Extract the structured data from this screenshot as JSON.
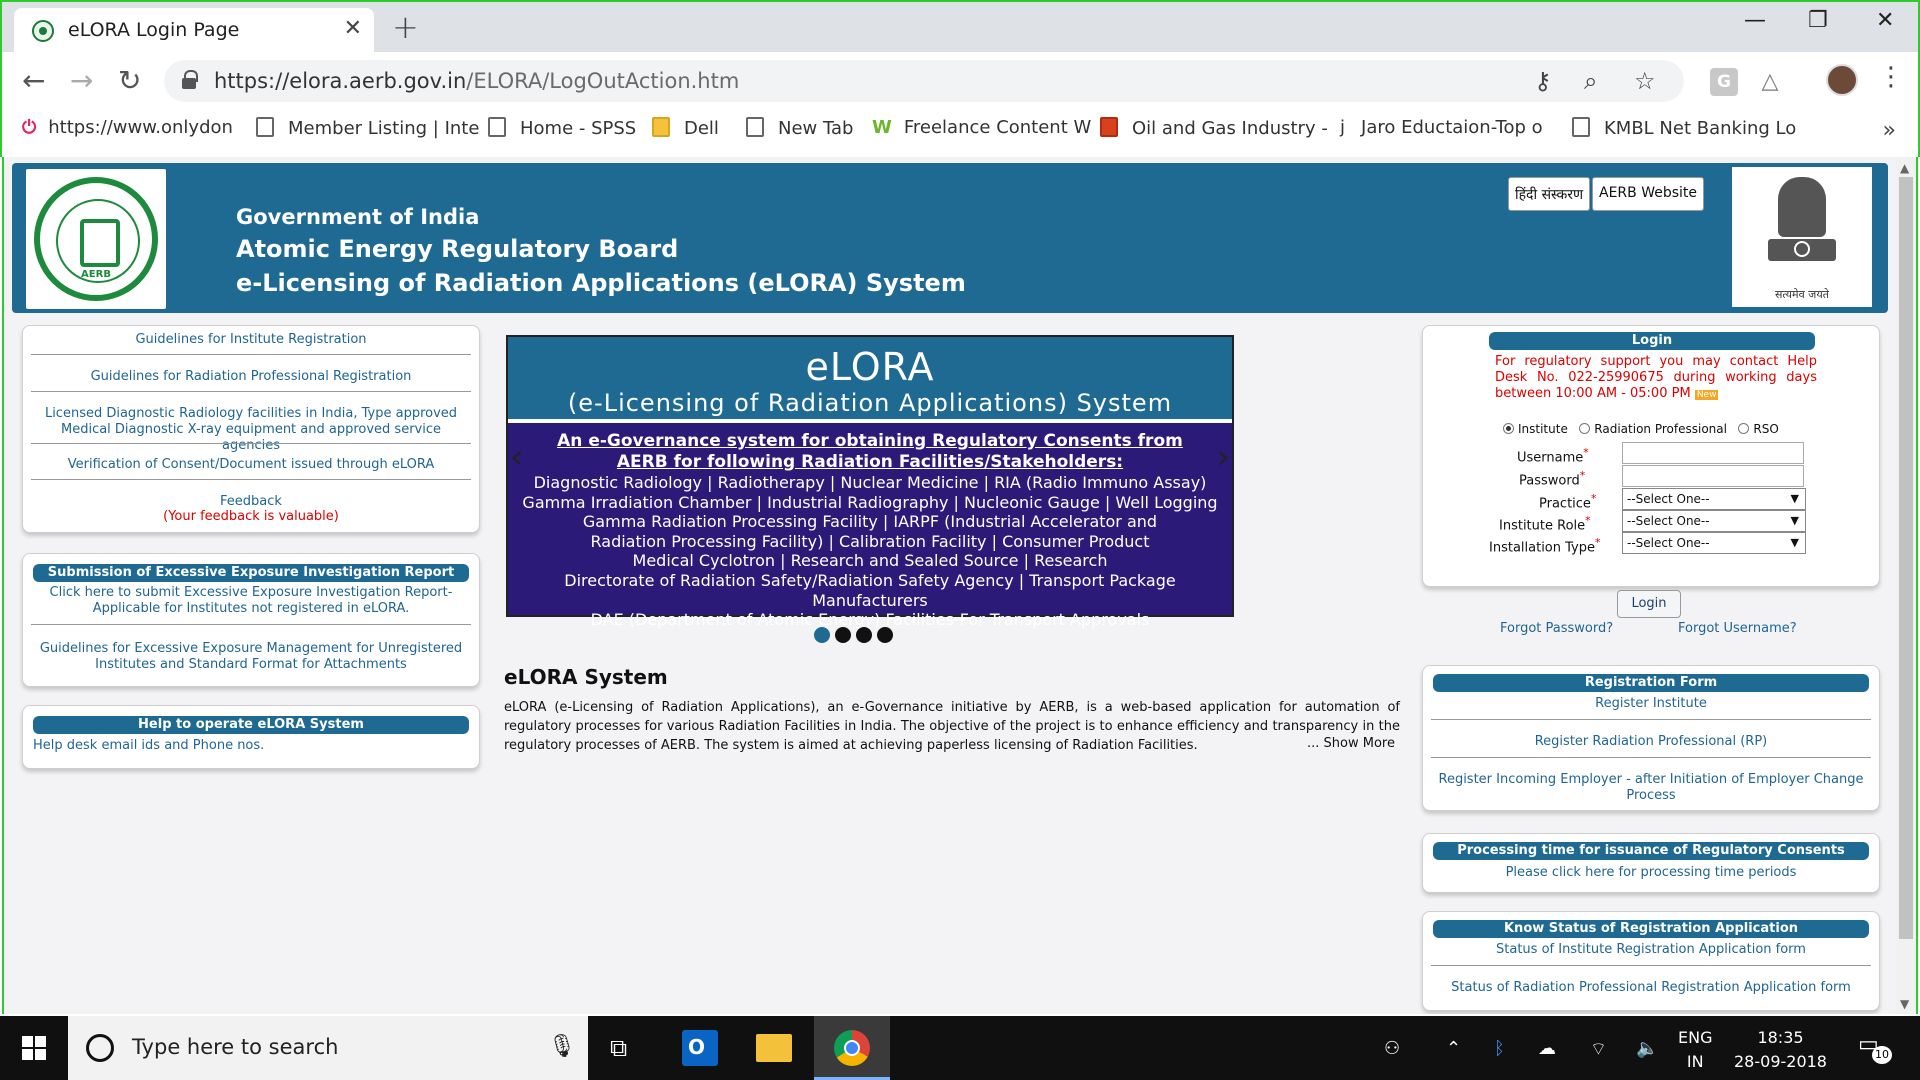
{
  "browser": {
    "tab_title": "eLORA Login Page",
    "url_host": "https://elora.aerb.gov.in",
    "url_path": "/ELORA/LogOutAction.htm",
    "bookmarks": [
      "https://www.onlydon",
      "Member Listing | Inte",
      "Home - SPSS",
      "Dell",
      "New Tab",
      "Freelance Content W",
      "Oil and Gas Industry -",
      "Jaro Eductaion-Top o",
      "KMBL Net Banking Lo"
    ]
  },
  "header": {
    "line1": "Government of India",
    "line2": "Atomic Energy Regulatory Board",
    "line3": "e-Licensing of Radiation Applications (eLORA) System",
    "hindi_button": "हिंदी संस्करण",
    "website_button": "AERB Website",
    "logo_text": "AERB",
    "emblem_text": "सत्यमेव जयते"
  },
  "left": {
    "links": [
      "Guidelines for Institute Registration",
      "Guidelines for Radiation Professional Registration",
      "Licensed Diagnostic Radiology facilities in India, Type approved Medical Diagnostic X-ray equipment and approved service agencies",
      "Verification of Consent/Document issued through eLORA",
      "Feedback"
    ],
    "feedback_note": "(Your feedback is valuable)",
    "exposure_title": "Submission of Excessive Exposure Investigation Report",
    "exposure_link": "Click here to submit Excessive Exposure Investigation Report-Applicable for Institutes not registered in eLORA.",
    "exposure_guidelines": "Guidelines for Excessive Exposure Management for Unregistered Institutes and Standard Format for Attachments",
    "help_title": "Help to operate eLORA System",
    "help_link": "Help desk email ids and Phone nos."
  },
  "carousel": {
    "title": "eLORA",
    "subtitle": "(e-Licensing of Radiation Applications) System",
    "heading1": "An e-Governance system for obtaining Regulatory Consents from",
    "heading2": "AERB for following Radiation Facilities/Stakeholders:",
    "lines": [
      "Diagnostic Radiology | Radiotherapy | Nuclear Medicine | RIA (Radio Immuno Assay)",
      "Gamma Irradiation Chamber | Industrial Radiography | Nucleonic Gauge | Well Logging",
      "Gamma Radiation Processing Facility | IARPF (Industrial Accelerator and",
      "Radiation Processing Facility) | Calibration Facility | Consumer Product",
      "Medical Cyclotron | Research and Sealed Source | Research",
      "Directorate of Radiation Safety/Radiation Safety Agency | Transport Package Manufacturers",
      "DAE (Department of Atomic Energy) Facilities-For Transport Approvals"
    ]
  },
  "system": {
    "title": "eLORA System",
    "body": "eLORA (e-Licensing of Radiation Applications), an e-Governance initiative by AERB, is a web-based application for automation of regulatory processes for various Radiation Facilities in India. The objective of the project is to enhance efficiency and transparency in the regulatory processes of AERB. The system is aimed at achieving paperless licensing of Radiation Facilities.",
    "show_more": "... Show More"
  },
  "login": {
    "title": "Login",
    "help_text": "For regulatory support you may contact Help Desk No. 022-25990675 during working days between 10:00 AM - 05:00 PM",
    "radio_institute": "Institute",
    "radio_rp": "Radiation Professional",
    "radio_rso": "RSO",
    "username_label": "Username",
    "password_label": "Password",
    "practice_label": "Practice",
    "role_label": "Institute Role",
    "install_label": "Installation Type",
    "select_default": "--Select One--",
    "button": "Login",
    "forgot_password": "Forgot Password?",
    "forgot_username": "Forgot Username?"
  },
  "registration": {
    "title": "Registration Form",
    "links": [
      "Register Institute",
      "Register Radiation Professional (RP)",
      "Register Incoming Employer - after Initiation of Employer Change Process"
    ]
  },
  "processing": {
    "title": "Processing time for issuance of Regulatory Consents",
    "link": "Please click here for processing time periods"
  },
  "status": {
    "title": "Know Status of Registration Application",
    "links": [
      "Status of Institute Registration Application form",
      "Status of Radiation Professional Registration Application form"
    ]
  },
  "taskbar": {
    "search_placeholder": "Type here to search",
    "lang1": "ENG",
    "lang2": "IN",
    "time": "18:35",
    "date": "28-09-2018",
    "notifications": "10"
  },
  "colors": {
    "brand_blue": "#1e6a93",
    "carousel_purple": "#2b1a78",
    "alert_red": "#dd0000",
    "window_border_green": "#2dcc2d"
  }
}
